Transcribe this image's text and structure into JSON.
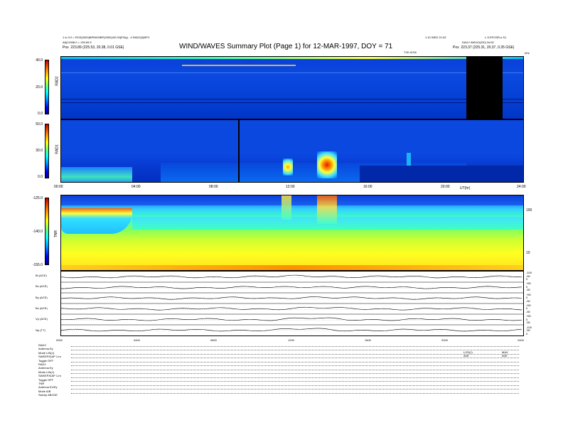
{
  "header": {
    "title": "WIND/WAVES Summary Plot (Page 1) for 12-MAR-1997, DOY = 71",
    "left_line1": "1 to 3.0 = RCE(0000)BPN000BP(0000)/02:00(ESty) - 4 RAD2(0)BPC",
    "left_line2": "A8(J1998.0 = 135.69 E",
    "left_line3_label": "Pos",
    "left_line3_value": "223.89 (225.53, 20.38, 0.01 GSE)",
    "right_line1": "1.10 WED 21:0Z",
    "right_line1b": "L.S.EFOSR.e.S1",
    "right_line2": "DAILY 8801/0(200) 3x/32",
    "right_line3_label": "Pos",
    "right_line3_value": "223.37 (225.31, 20.37, 0.35 GSE)",
    "marker_label": "T1E:41S6",
    "unit_right": "kHz"
  },
  "chart_data": [
    {
      "type": "heatmap",
      "name": "RAD2",
      "y_ticks": [
        "40.0",
        "20.0",
        "0.0"
      ],
      "ylim": [
        0,
        40
      ],
      "x_ticks": [],
      "features": {
        "data_gap_hours": [
          22.2,
          23.8
        ]
      }
    },
    {
      "type": "heatmap",
      "name": "RAD1",
      "y_ticks": [
        "50.0",
        "30.0",
        "0.0"
      ],
      "ylim": [
        0,
        50
      ],
      "x_ticks": [
        "00:00",
        "04:00",
        "08:00",
        "12:00",
        "16:00",
        "20:00",
        "24:00"
      ],
      "xlim": [
        0,
        24
      ],
      "x_axis_label": "UT(hr)",
      "features": {
        "data_gap_hours": [
          9.5,
          9.6
        ]
      }
    },
    {
      "type": "heatmap",
      "name": "TNR",
      "y_ticks": [
        "-125.0",
        "-140.0",
        "-155.0"
      ],
      "ylim": [
        -155,
        -125
      ],
      "right_ticks": [
        "100",
        "10"
      ],
      "x_ticks": []
    },
    {
      "type": "line",
      "name": "ACE stack",
      "rows": [
        {
          "label": "Bt (ACE)",
          "right_ticks": [
            "-100",
            "-50",
            "0"
          ]
        },
        {
          "label": "Bx (ACE)",
          "right_ticks": [
            "+50",
            "0",
            "-50"
          ]
        },
        {
          "label": "By (ACE)",
          "right_ticks": [
            "+50",
            "0",
            "-50"
          ]
        },
        {
          "label": "Bz (ACE)",
          "right_ticks": [
            "+50",
            "0",
            "-50"
          ]
        },
        {
          "label": "Vp (ACE)",
          "right_ticks": [
            "+50",
            "0",
            "-50"
          ]
        },
        {
          "label": "Np (TT)",
          "right_ticks": [
            "-100",
            "-50",
            "0"
          ]
        }
      ],
      "x_ticks": [
        "0000",
        "0400",
        "0800",
        "1200",
        "1600",
        "2000",
        "2400"
      ],
      "xlim": [
        0,
        24
      ]
    }
  ],
  "footer": {
    "rad2": [
      "RAD2",
      "Antenna    Ey",
      "Mode     LIN(J)",
      "SWEEP/DAP 1-hr",
      "Toggle    OFF"
    ],
    "rad1": [
      "RAD1",
      "Antenna    Ey",
      "Mode     LIN(J)",
      "SWEEP/DAP 1-hr",
      "Toggle    OFF"
    ],
    "tnr": [
      "TNR",
      "Antenna   Ex/Ey",
      "Mode      A/B",
      "Sweep   ABCDE"
    ],
    "right_col1": [
      "LOS(J)",
      "AVE"
    ],
    "right_col2": [
      "MAX",
      "AVE"
    ]
  }
}
